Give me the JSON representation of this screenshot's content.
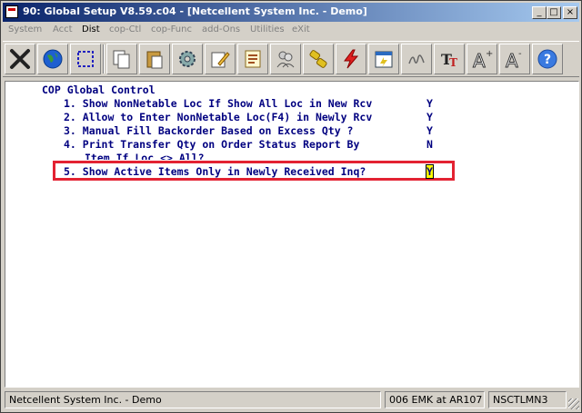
{
  "window": {
    "title": "90: Global Setup V8.59.c04 - [Netcellent System Inc. - Demo]"
  },
  "caption_buttons": {
    "minimize": "_",
    "maximize": "□",
    "close": "×"
  },
  "menu": [
    {
      "label": "System",
      "enabled": false
    },
    {
      "label": "Acct",
      "enabled": false
    },
    {
      "label": "Dist",
      "enabled": true
    },
    {
      "label": "cop-Ctl",
      "enabled": false
    },
    {
      "label": "cop-Func",
      "enabled": false
    },
    {
      "label": "add-Ons",
      "enabled": false
    },
    {
      "label": "Utilities",
      "enabled": false
    },
    {
      "label": "eXit",
      "enabled": false
    }
  ],
  "toolbar": [
    {
      "name": "exit-icon"
    },
    {
      "name": "globe-icon"
    },
    {
      "name": "select-icon"
    },
    {
      "name": "copy-icon"
    },
    {
      "name": "paste-icon"
    },
    {
      "name": "settings-icon"
    },
    {
      "name": "edit-icon"
    },
    {
      "name": "notes-icon"
    },
    {
      "name": "users-icon"
    },
    {
      "name": "link-icon"
    },
    {
      "name": "lightning-icon"
    },
    {
      "name": "calendar-icon"
    },
    {
      "name": "signature-icon"
    },
    {
      "name": "font-icon"
    },
    {
      "name": "font-increase-icon"
    },
    {
      "name": "font-decrease-icon"
    },
    {
      "name": "help-icon"
    }
  ],
  "screen": {
    "heading": "COP Global Control",
    "options": [
      {
        "label": "1. Show NonNetable Loc If Show All Loc in New Rcv",
        "value": "Y"
      },
      {
        "label": "2. Allow to Enter NonNetable Loc(F4) in Newly Rcv",
        "value": "Y"
      },
      {
        "label": "3. Manual Fill Backorder Based on Excess Qty ?",
        "value": "Y"
      },
      {
        "label": "4. Print Transfer Qty on Order Status Report By",
        "value": "N",
        "continuation": "Item If Loc <> All?"
      },
      {
        "label": "5. Show Active Items Only in Newly Received Inq?",
        "value": "Y"
      }
    ]
  },
  "status": {
    "company": "Netcellent System Inc. - Demo",
    "user": "006 EMK at AR107",
    "station": "NSCTLMN3"
  }
}
